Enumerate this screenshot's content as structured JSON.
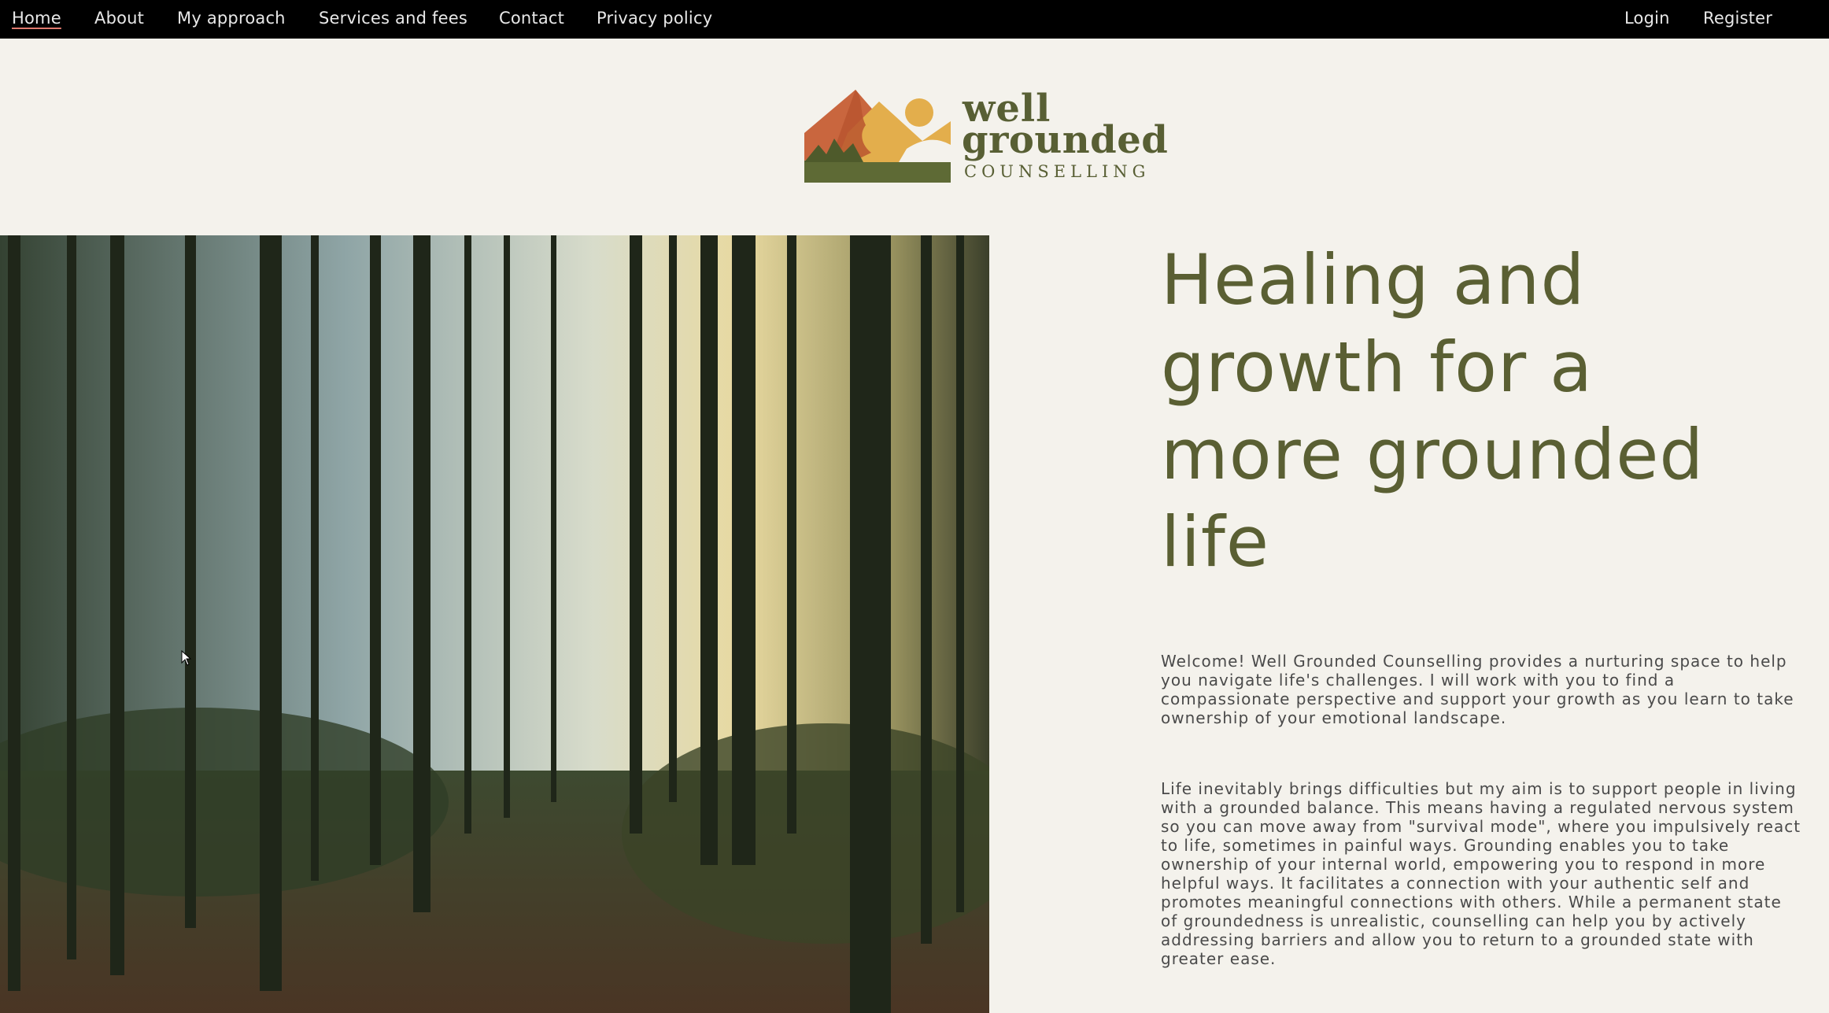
{
  "nav": {
    "left": [
      "Home",
      "About",
      "My approach",
      "Services and fees",
      "Contact",
      "Privacy policy"
    ],
    "right": [
      "Login",
      "Register"
    ],
    "active": "Home"
  },
  "logo": {
    "line1": "well",
    "line2": "grounded",
    "line3": "COUNSELLING",
    "colors": {
      "orange": "#c9663e",
      "gold": "#e3ae4c",
      "olive": "#5e6a35"
    }
  },
  "hero": {
    "image_icon": "forest-photo",
    "title": "Healing and growth for a more grounded life",
    "paragraphs": [
      "Welcome! Well Grounded Counselling provides a nurturing space to help you navigate life's challenges. I will work with you to find a compassionate perspective and support your growth as you learn to take ownership of your emotional landscape.",
      "Life inevitably brings difficulties but my aim is to support people in living with a grounded balance. This means having a regulated nervous system so you can move away from \"survival mode\", where you impulsively react to life, sometimes in painful ways. Grounding enables you to take ownership of your internal world, empowering you to respond in more helpful ways. It facilitates a connection with your authentic self and promotes meaningful connections with others. While a permanent state of groundedness is unrealistic, counselling can help you by actively addressing barriers and allow you to return to a grounded state with greater ease."
    ]
  },
  "colors": {
    "nav_bg": "#000000",
    "page_bg": "#f4f2ec",
    "title": "#5a5f33",
    "text": "#4a4a4a"
  }
}
